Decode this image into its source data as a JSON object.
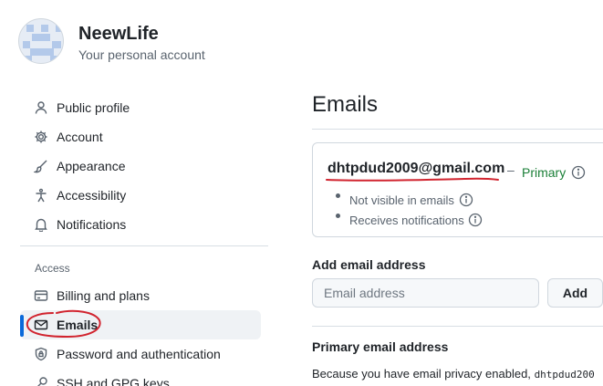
{
  "account": {
    "name": "NeewLife",
    "subtitle": "Your personal account"
  },
  "sidebar": {
    "items": [
      {
        "label": "Public profile",
        "icon": "person-icon"
      },
      {
        "label": "Account",
        "icon": "gear-icon"
      },
      {
        "label": "Appearance",
        "icon": "paintbrush-icon"
      },
      {
        "label": "Accessibility",
        "icon": "accessibility-icon"
      },
      {
        "label": "Notifications",
        "icon": "bell-icon"
      }
    ],
    "access_label": "Access",
    "access_items": [
      {
        "label": "Billing and plans",
        "icon": "credit-card-icon"
      },
      {
        "label": "Emails",
        "icon": "mail-icon",
        "active": true
      },
      {
        "label": "Password and authentication",
        "icon": "shield-lock-icon"
      },
      {
        "label": "SSH and GPG keys",
        "icon": "key-icon"
      }
    ]
  },
  "main": {
    "title": "Emails",
    "email": {
      "address": "dhtpdud2009@gmail.com",
      "dash": "–",
      "badge": "Primary",
      "bullets": [
        "Not visible in emails",
        "Receives notifications"
      ]
    },
    "add_email": {
      "heading": "Add email address",
      "placeholder": "Email address",
      "button": "Add"
    },
    "primary_email": {
      "heading": "Primary email address",
      "text_prefix": "Because you have email privacy enabled,",
      "mono_fragment": "dhtpdud200"
    }
  },
  "colors": {
    "accent": "#0969da",
    "primary_badge": "#1a7f37",
    "annotation": "#d1242f",
    "active_bg": "#eff2f5"
  }
}
